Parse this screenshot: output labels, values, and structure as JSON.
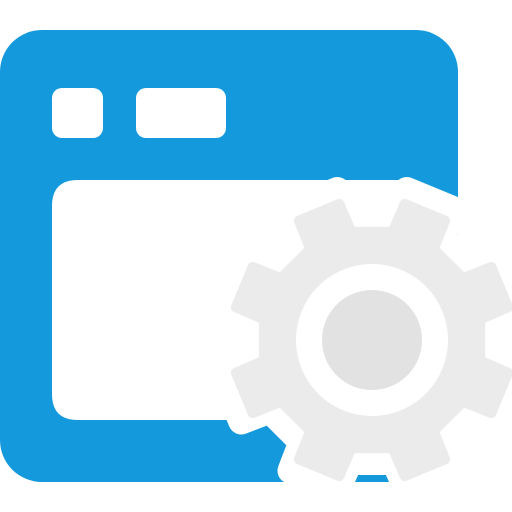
{
  "icon": {
    "name": "application-settings-icon",
    "colors": {
      "window_blue": "#1499dc",
      "window_inner": "#ffffff",
      "gear_gray": "#ebebeb",
      "hub_gray": "#e2e2e2",
      "background": "#ffffff"
    }
  }
}
